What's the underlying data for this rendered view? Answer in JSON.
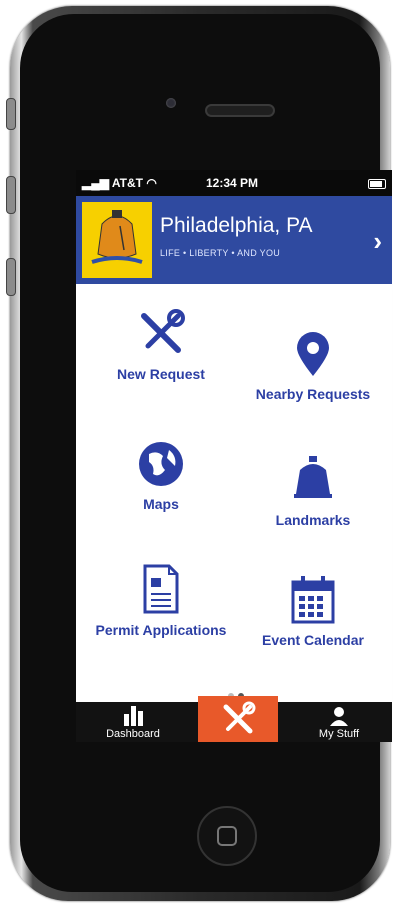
{
  "status": {
    "carrier": "AT&T",
    "time": "12:34 PM"
  },
  "header": {
    "title": "Philadelphia, PA",
    "subtitle": "LIFE • LIBERTY • AND YOU"
  },
  "menu": {
    "items": [
      {
        "label": "New Request",
        "icon": "tools-icon"
      },
      {
        "label": "Nearby Requests",
        "icon": "map-pin-icon"
      },
      {
        "label": "Maps",
        "icon": "globe-icon"
      },
      {
        "label": "Landmarks",
        "icon": "liberty-bell-icon"
      },
      {
        "label": "Permit Applications",
        "icon": "document-icon"
      },
      {
        "label": "Event Calendar",
        "icon": "calendar-icon"
      }
    ]
  },
  "tabbar": {
    "tabs": [
      {
        "label": "Dashboard",
        "icon": "dashboard-icon"
      },
      {
        "label": "",
        "icon": "tools-icon"
      },
      {
        "label": "My Stuff",
        "icon": "person-icon"
      }
    ]
  },
  "colors": {
    "brand": "#2f4aa0",
    "accent": "#e8592a",
    "text": "#2c3fa4"
  },
  "pager": {
    "pages": 2,
    "current": 2
  }
}
